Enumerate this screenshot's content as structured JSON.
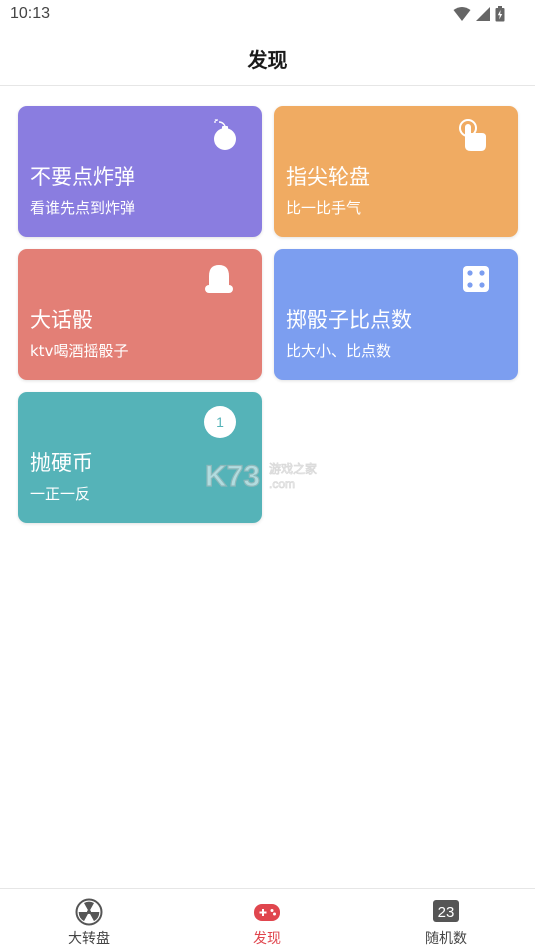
{
  "status_bar": {
    "time": "10:13"
  },
  "header": {
    "title": "发现"
  },
  "cards": [
    {
      "title": "不要点炸弹",
      "subtitle": "看谁先点到炸弹",
      "color": "#8a7de0",
      "icon": "bomb-icon"
    },
    {
      "title": "指尖轮盘",
      "subtitle": "比一比手气",
      "color": "#f0ab62",
      "icon": "pointer-hand-icon"
    },
    {
      "title": "大话骰",
      "subtitle": "ktv喝酒摇骰子",
      "color": "#e37f76",
      "icon": "dice-cup-icon"
    },
    {
      "title": "掷骰子比点数",
      "subtitle": "比大小、比点数",
      "color": "#7c9ef0",
      "icon": "dice-icon"
    },
    {
      "title": "抛硬币",
      "subtitle": "一正一反",
      "color": "#55b3b8",
      "icon": "coin-icon",
      "coin_label": "1"
    }
  ],
  "watermark": {
    "brand": "K73",
    "line1": "游戏之家",
    "line2": ".com"
  },
  "tabs": [
    {
      "label": "大转盘",
      "icon": "wheel-icon",
      "active": false
    },
    {
      "label": "发现",
      "icon": "gamepad-icon",
      "active": true
    },
    {
      "label": "随机数",
      "icon": "random-number-icon",
      "icon_text": "23",
      "active": false
    }
  ],
  "colors": {
    "accent": "#e0464e",
    "tab_inactive": "#444444"
  }
}
